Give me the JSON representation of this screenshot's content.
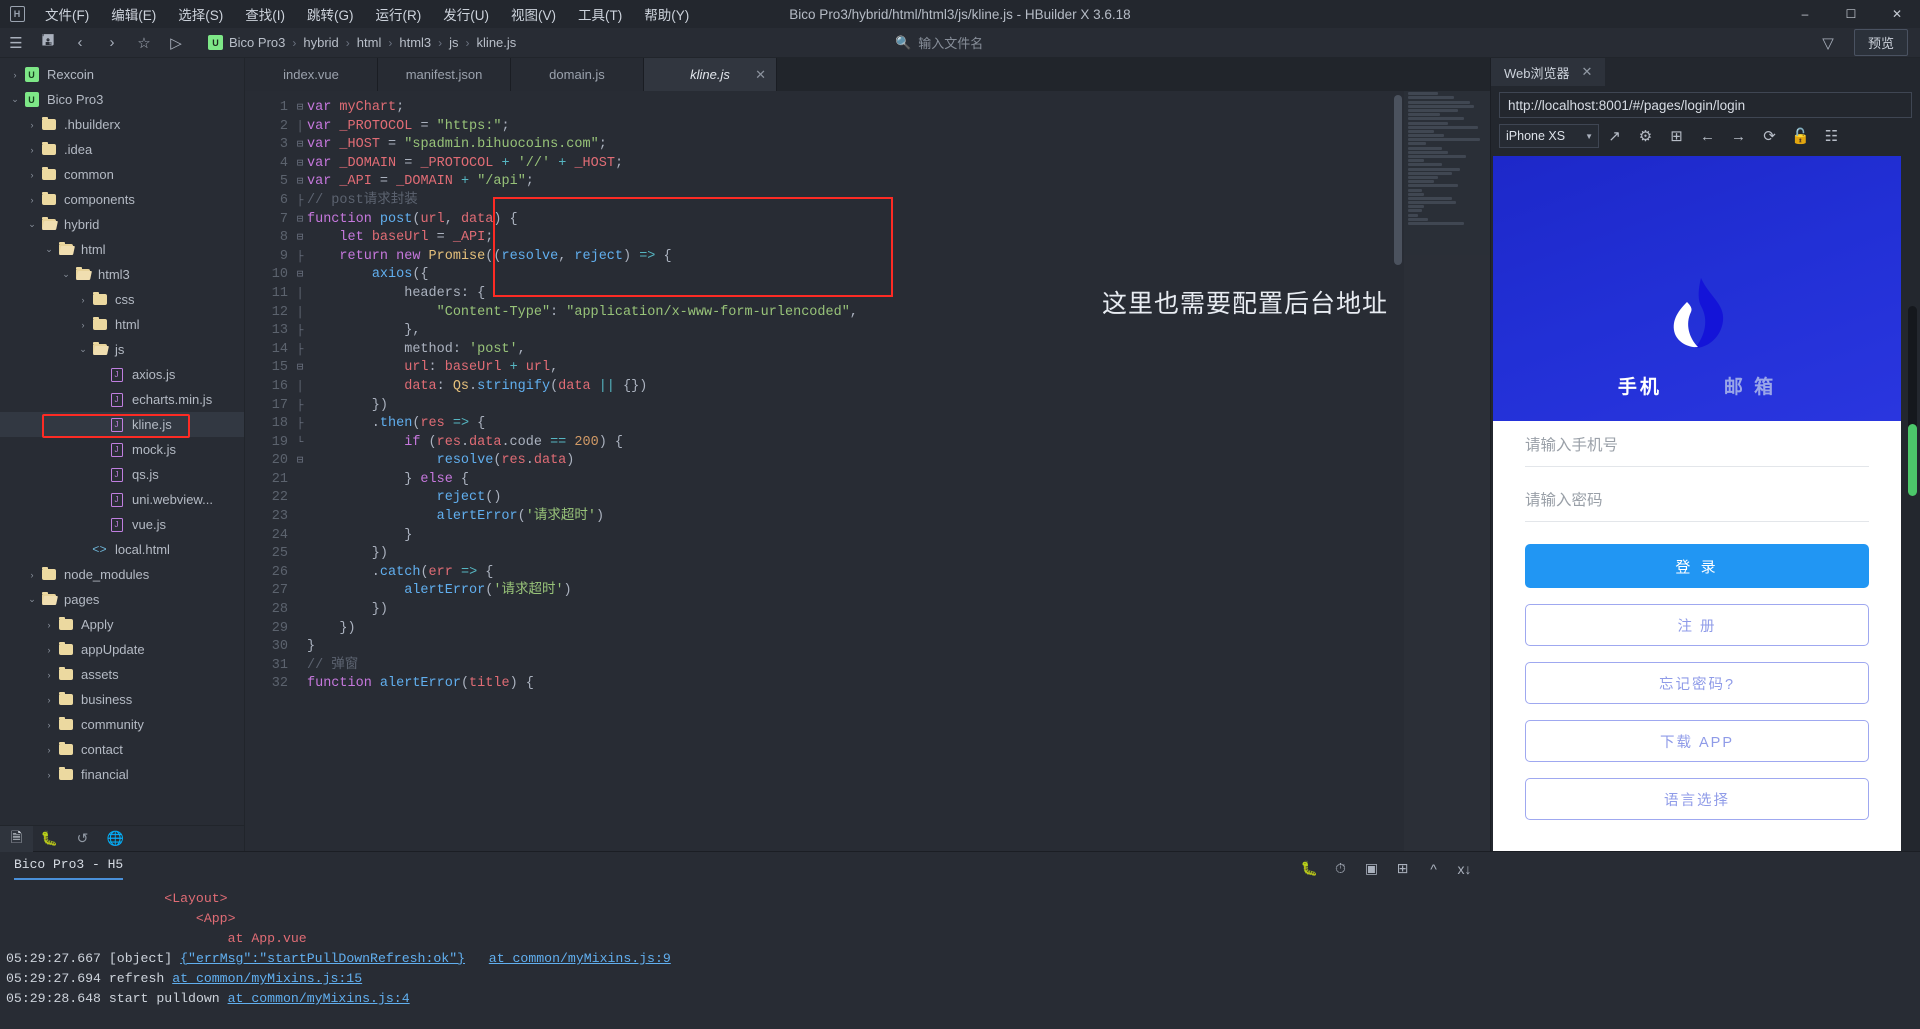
{
  "window": {
    "title": "Bico Pro3/hybrid/html/html3/js/kline.js - HBuilder X 3.6.18",
    "minimize": "–",
    "maximize": "▢",
    "close": "✕"
  },
  "menu": {
    "items": [
      "文件(F)",
      "编辑(E)",
      "选择(S)",
      "查找(I)",
      "跳转(G)",
      "运行(R)",
      "发行(U)",
      "视图(V)",
      "工具(T)",
      "帮助(Y)"
    ]
  },
  "toolbar": {
    "icons": [
      "panel-toggle-icon",
      "save-icon",
      "back-icon",
      "forward-icon",
      "star-icon",
      "run-icon"
    ],
    "breadcrumb": [
      "Bico Pro3",
      "hybrid",
      "html",
      "html3",
      "js",
      "kline.js"
    ],
    "file_search_placeholder": "输入文件名",
    "filter_icon": "filter-icon",
    "preview_label": "预览"
  },
  "sidebar": {
    "tree": [
      {
        "label": "Rexcoin",
        "depth": 0,
        "arrow": "›",
        "icon": "uni-project"
      },
      {
        "label": "Bico Pro3",
        "depth": 0,
        "arrow": "⌄",
        "icon": "uni-project"
      },
      {
        "label": ".hbuilderx",
        "depth": 1,
        "arrow": "›",
        "icon": "folder"
      },
      {
        "label": ".idea",
        "depth": 1,
        "arrow": "›",
        "icon": "folder"
      },
      {
        "label": "common",
        "depth": 1,
        "arrow": "›",
        "icon": "folder"
      },
      {
        "label": "components",
        "depth": 1,
        "arrow": "›",
        "icon": "folder"
      },
      {
        "label": "hybrid",
        "depth": 1,
        "arrow": "⌄",
        "icon": "folder-open"
      },
      {
        "label": "html",
        "depth": 2,
        "arrow": "⌄",
        "icon": "folder-open"
      },
      {
        "label": "html3",
        "depth": 3,
        "arrow": "⌄",
        "icon": "folder-open"
      },
      {
        "label": "css",
        "depth": 4,
        "arrow": "›",
        "icon": "folder"
      },
      {
        "label": "html",
        "depth": 4,
        "arrow": "›",
        "icon": "folder"
      },
      {
        "label": "js",
        "depth": 4,
        "arrow": "⌄",
        "icon": "folder-open"
      },
      {
        "label": "axios.js",
        "depth": 5,
        "arrow": "",
        "icon": "js"
      },
      {
        "label": "echarts.min.js",
        "depth": 5,
        "arrow": "",
        "icon": "js"
      },
      {
        "label": "kline.js",
        "depth": 5,
        "arrow": "",
        "icon": "js",
        "selected": true,
        "highlighted": true
      },
      {
        "label": "mock.js",
        "depth": 5,
        "arrow": "",
        "icon": "js"
      },
      {
        "label": "qs.js",
        "depth": 5,
        "arrow": "",
        "icon": "js"
      },
      {
        "label": "uni.webview...",
        "depth": 5,
        "arrow": "",
        "icon": "js"
      },
      {
        "label": "vue.js",
        "depth": 5,
        "arrow": "",
        "icon": "js"
      },
      {
        "label": "local.html",
        "depth": 4,
        "arrow": "",
        "icon": "html"
      },
      {
        "label": "node_modules",
        "depth": 1,
        "arrow": "›",
        "icon": "folder"
      },
      {
        "label": "pages",
        "depth": 1,
        "arrow": "⌄",
        "icon": "folder-open"
      },
      {
        "label": "Apply",
        "depth": 2,
        "arrow": "›",
        "icon": "folder"
      },
      {
        "label": "appUpdate",
        "depth": 2,
        "arrow": "›",
        "icon": "folder"
      },
      {
        "label": "assets",
        "depth": 2,
        "arrow": "›",
        "icon": "folder"
      },
      {
        "label": "business",
        "depth": 2,
        "arrow": "›",
        "icon": "folder"
      },
      {
        "label": "community",
        "depth": 2,
        "arrow": "›",
        "icon": "folder"
      },
      {
        "label": "contact",
        "depth": 2,
        "arrow": "›",
        "icon": "folder"
      },
      {
        "label": "financial",
        "depth": 2,
        "arrow": "›",
        "icon": "folder"
      }
    ],
    "bottom_tabs": [
      "project-explorer-icon",
      "debug-icon",
      "terminal-icon",
      "network-icon"
    ]
  },
  "editor": {
    "tabs": [
      {
        "label": "index.vue",
        "active": false
      },
      {
        "label": "manifest.json",
        "active": false
      },
      {
        "label": "domain.js",
        "active": false
      },
      {
        "label": "kline.js",
        "active": true,
        "close": "✕"
      }
    ],
    "annotation_text": "这里也需要配置后台地址",
    "line_count": 32,
    "lines": [
      "var myChart;",
      "var _PROTOCOL = \"https:\";",
      "var _HOST = \"spadmin.bihuocoins.com\";",
      "var _DOMAIN = _PROTOCOL + '//' + _HOST;",
      "var _API = _DOMAIN + \"/api\";",
      "// post请求封装",
      "function post(url, data) {",
      "    let baseUrl = _API;",
      "    return new Promise((resolve, reject) => {",
      "        axios({",
      "            headers: {",
      "                \"Content-Type\": \"application/x-www-form-urlencoded\",",
      "            },",
      "            method: 'post',",
      "            url: baseUrl + url,",
      "            data: Qs.stringify(data || {})",
      "        })",
      "        .then(res => {",
      "            if (res.data.code == 200) {",
      "                resolve(res.data)",
      "            } else {",
      "                reject()",
      "                alertError('请求超时')",
      "            }",
      "        })",
      "        .catch(err => {",
      "            alertError('请求超时')",
      "        })",
      "    })",
      "}",
      "// 弹窗",
      "function alertError(title) {"
    ]
  },
  "preview": {
    "tab_label": "Web浏览器",
    "tab_close": "✕",
    "url": "http://localhost:8001/#/pages/login/login",
    "device": "iPhone XS",
    "controls": [
      "open-external-icon",
      "settings-gear-icon",
      "console-icon",
      "back-arrow-icon",
      "forward-arrow-icon",
      "reload-icon",
      "lock-icon",
      "grid-icon"
    ],
    "app": {
      "tabs": [
        {
          "label": "手机",
          "active": true
        },
        {
          "label": "邮 箱",
          "active": false
        }
      ],
      "phone_placeholder": "请输入手机号",
      "password_placeholder": "请输入密码",
      "buttons": [
        {
          "label": "登 录",
          "style": "primary"
        },
        {
          "label": "注 册",
          "style": "outline"
        },
        {
          "label": "忘记密码?",
          "style": "outline"
        },
        {
          "label": "下载 APP",
          "style": "outline"
        },
        {
          "label": "语言选择",
          "style": "outline"
        }
      ]
    }
  },
  "console": {
    "title": "Bico Pro3 - H5",
    "icons": [
      "bug-icon",
      "run-debug-icon",
      "stop-icon",
      "new-terminal-icon",
      "collapse-icon",
      "clear-icon"
    ],
    "lines": [
      {
        "indent": 10,
        "text": "<Layout>",
        "type": "tag"
      },
      {
        "indent": 12,
        "text": "<App>",
        "type": "tag"
      },
      {
        "indent": 14,
        "text": "at App.vue",
        "type": "tag"
      },
      {
        "ts": "05:29:27.667",
        "text": "[object] ",
        "link": "{\"errMsg\":\"startPullDownRefresh:ok\"}",
        "link2": "at common/myMixins.js:9"
      },
      {
        "ts": "05:29:27.694",
        "text": "refresh ",
        "link2": "at common/myMixins.js:15"
      },
      {
        "ts": "05:29:28.648",
        "text": "start pulldown ",
        "link2": "at common/myMixins.js:4"
      }
    ]
  },
  "colors": {
    "accent": "#2196f3",
    "annotation": "#fd2b24",
    "brand_blue": "#1d28c9",
    "bg": "#282c34"
  }
}
